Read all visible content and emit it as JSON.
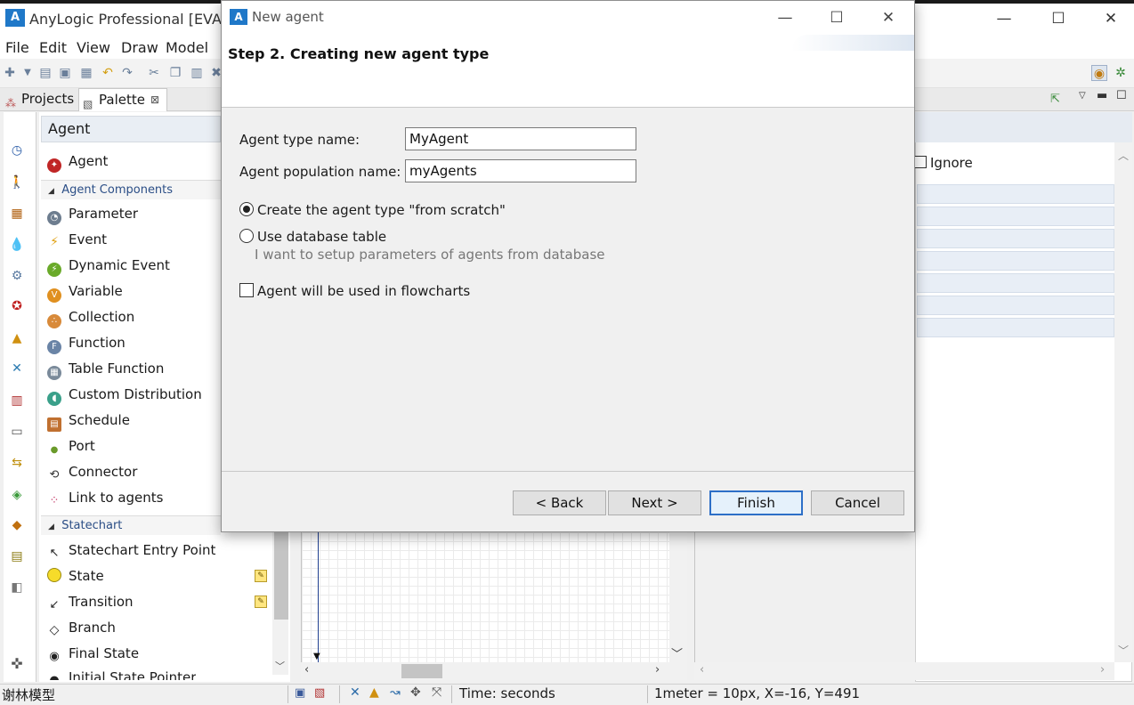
{
  "app": {
    "title": "AnyLogic Professional [EVALU",
    "menu": [
      "File",
      "Edit",
      "View",
      "Draw",
      "Model"
    ]
  },
  "views": {
    "projects_tab": "Projects",
    "palette_tab": "Palette",
    "close_glyph": "⊠"
  },
  "palette": {
    "header": "Agent",
    "agent_item": "Agent",
    "section_components": "Agent Components",
    "components": [
      "Parameter",
      "Event",
      "Dynamic Event",
      "Variable",
      "Collection",
      "Function",
      "Table Function",
      "Custom Distribution",
      "Schedule",
      "Port",
      "Connector",
      "Link to agents"
    ],
    "section_statechart": "Statechart",
    "statechart": [
      "Statechart Entry Point",
      "State",
      "Transition",
      "Branch",
      "Final State"
    ],
    "partial_item": "Initial State Pointer"
  },
  "properties": {
    "ignore_label": "Ignore"
  },
  "status": {
    "user": "谢林模型",
    "time": "Time: seconds",
    "scale": "1meter = 10px, X=-16, Y=491"
  },
  "dialog": {
    "title": "New agent",
    "step_title": "Step 2. Creating new agent type",
    "type_name_label": "Agent type name:",
    "type_name_value": "MyAgent",
    "population_label": "Agent population name:",
    "population_value": "myAgents",
    "option_scratch": "Create the agent type \"from scratch\"",
    "option_db": "Use database table",
    "db_hint": "I want to setup parameters of agents from database",
    "flowchart_label": "Agent will be used in flowcharts",
    "buttons": {
      "back": "< Back",
      "next": "Next >",
      "finish": "Finish",
      "cancel": "Cancel"
    }
  },
  "colors": {
    "accent": "#1f78c8",
    "finish_border": "#2d6fc7"
  }
}
